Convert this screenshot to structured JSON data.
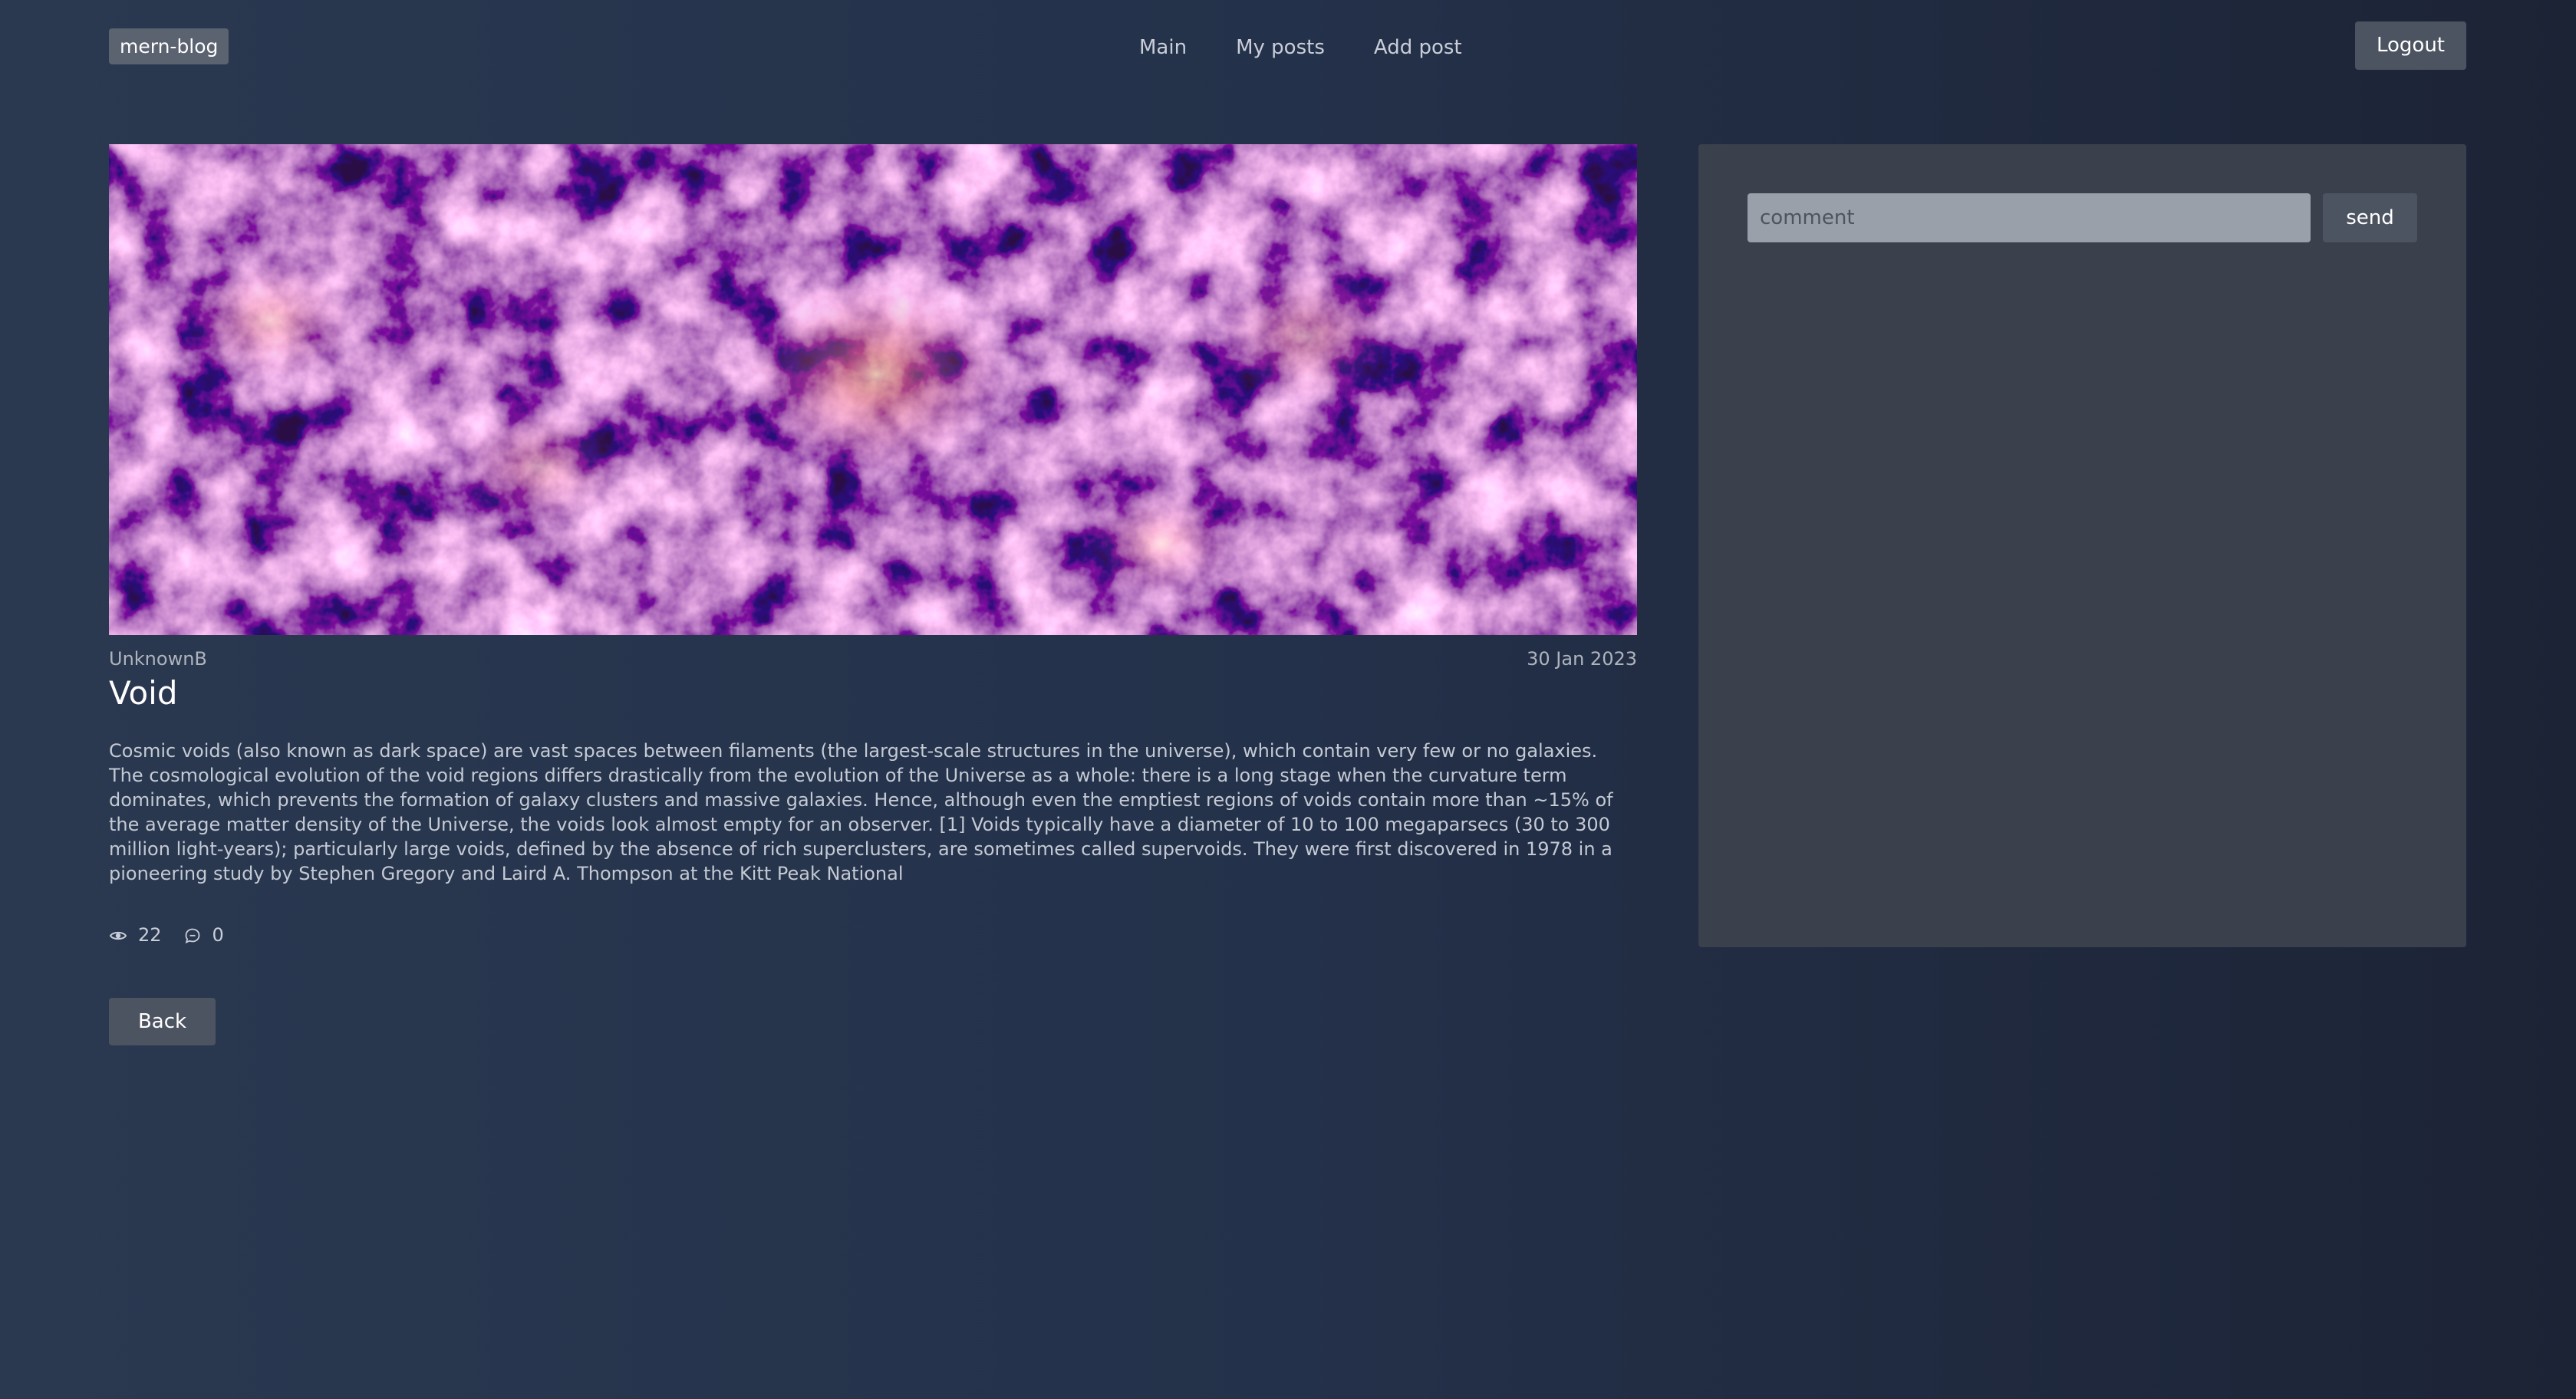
{
  "navbar": {
    "logo": "mern-blog",
    "links": [
      "Main",
      "My posts",
      "Add post"
    ],
    "logout_label": "Logout"
  },
  "post": {
    "image_alt": "cosmic web",
    "author": "UnknownB",
    "date": "30 Jan 2023",
    "title": "Void",
    "body": "Cosmic voids (also known as dark space) are vast spaces between filaments (the largest-scale structures in the universe), which contain very few or no galaxies. The cosmological evolution of the void regions differs drastically from the evolution of the Universe as a whole: there is a long stage when the curvature term dominates, which prevents the formation of galaxy clusters and massive galaxies. Hence, although even the emptiest regions of voids contain more than ~15% of the average matter density of the Universe, the voids look almost empty for an observer. [1] Voids typically have a diameter of 10 to 100 megaparsecs (30 to 300 million light-years); particularly large voids, defined by the absence of rich superclusters, are sometimes called supervoids. They were first discovered in 1978 in a pioneering study by Stephen Gregory and Laird A. Thompson at the Kitt Peak National",
    "views": "22",
    "comments_count": "0",
    "back_label": "Back"
  },
  "comments": {
    "placeholder": "comment",
    "value": "",
    "send_label": "send"
  },
  "icons": {
    "views": "eye-icon",
    "comments": "chat-bubble-icon"
  },
  "colors": {
    "button_bg": "#4d5461",
    "panel_bg": "#3a404c",
    "input_bg": "#9aa0a9"
  }
}
